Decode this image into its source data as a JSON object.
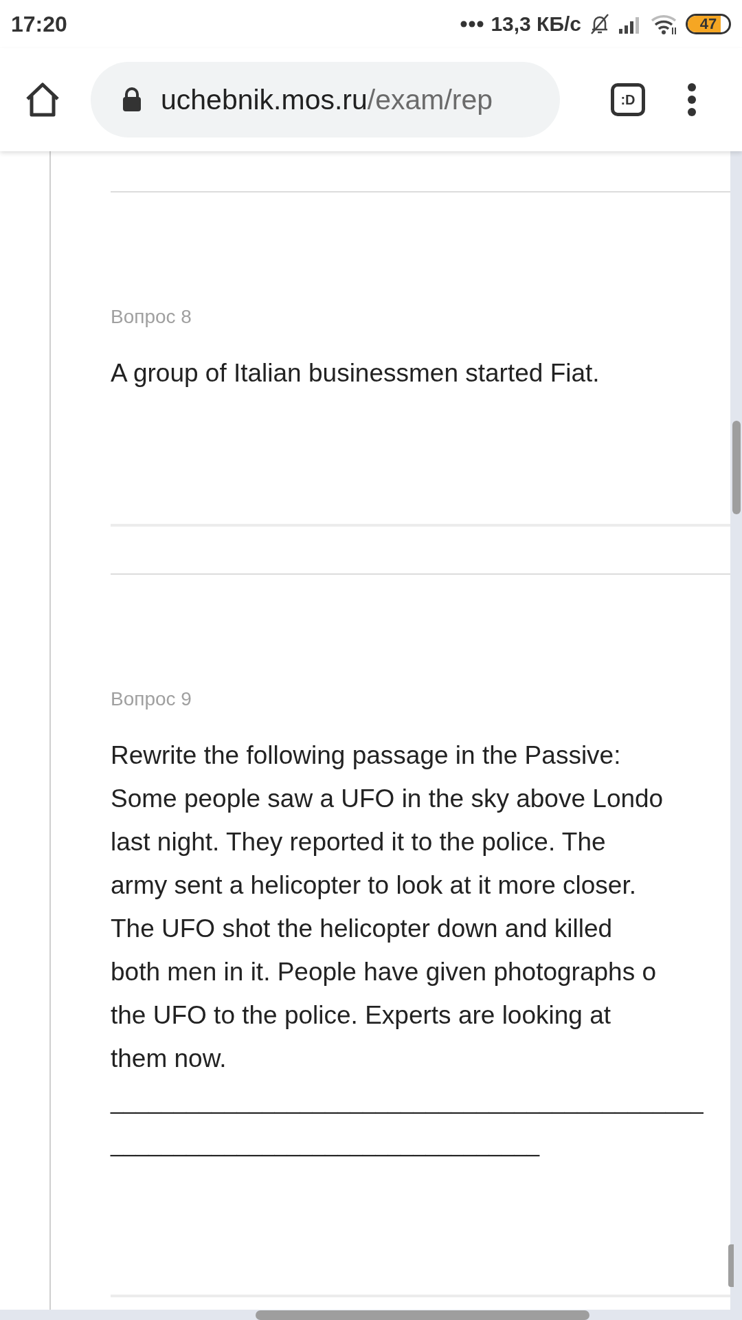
{
  "status_bar": {
    "time": "17:20",
    "network_speed": "13,3 КБ/с",
    "battery": "47"
  },
  "toolbar": {
    "url_host": "uchebnik.mos.ru",
    "url_path": "/exam/rep",
    "tab_button": ":D"
  },
  "questions": [
    {
      "label": "Вопрос 8",
      "lines": [
        "A group of Italian businessmen started Fiat."
      ]
    },
    {
      "label": "Вопрос 9",
      "lines": [
        "Rewrite the following passage in the Passive:",
        "Some people saw a UFO in the sky above Londo",
        "last night. They reported it to the police. The",
        "army sent a helicopter to look at it more closer.",
        "The UFO shot the helicopter down and killed",
        "both men in it. People have given photographs o",
        "the UFO to the police. Experts are looking at",
        "them now."
      ],
      "answer_lines": [
        "_______________________________________________",
        "__________________________________"
      ]
    }
  ]
}
